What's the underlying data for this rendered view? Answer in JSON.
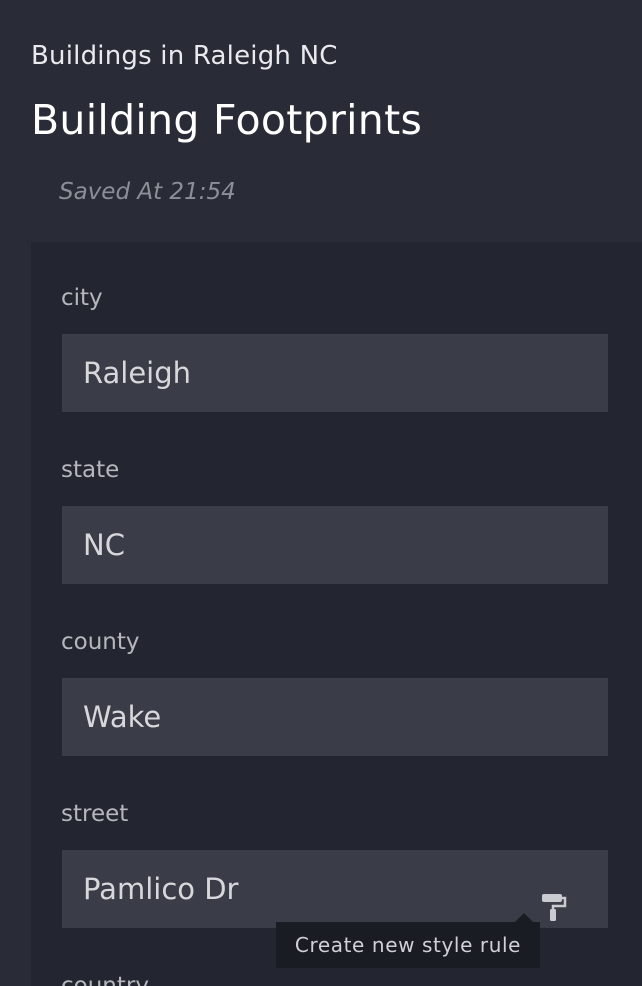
{
  "header": {
    "layer_name": "Buildings in Raleigh NC",
    "title": "Building Footprints",
    "saved_at": "Saved At 21:54"
  },
  "fields": [
    {
      "label": "city",
      "value": "Raleigh"
    },
    {
      "label": "state",
      "value": "NC"
    },
    {
      "label": "county",
      "value": "Wake"
    },
    {
      "label": "street",
      "value": "Pamlico Dr"
    },
    {
      "label": "country",
      "value": ""
    }
  ],
  "tooltip": {
    "text": "Create new style rule"
  },
  "icons": {
    "style_rule": "paint-roller-icon"
  },
  "colors": {
    "background": "#292c36",
    "panel": "#232630",
    "input": "#3a3d47",
    "tooltip": "#1a1c23"
  }
}
